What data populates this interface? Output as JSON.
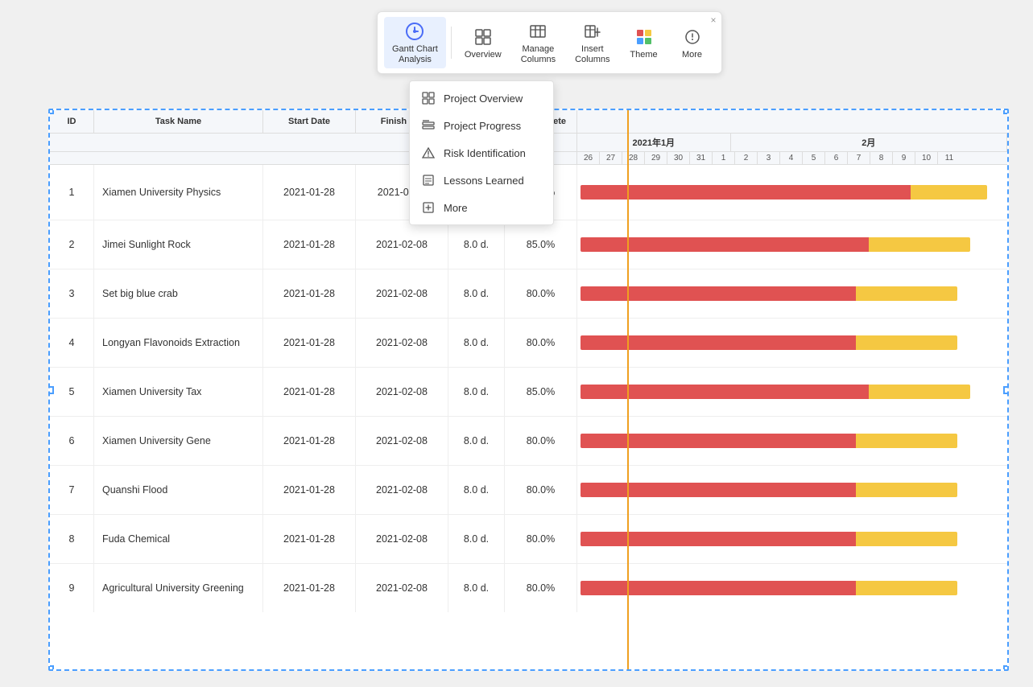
{
  "toolbar": {
    "close_label": "×",
    "items": [
      {
        "id": "gantt-chart-analysis",
        "label": "Gantt Chart\nAnalysis",
        "icon": "gantt-icon",
        "active": true
      },
      {
        "id": "overview",
        "label": "Overview",
        "icon": "overview-icon"
      },
      {
        "id": "manage-columns",
        "label": "Manage\nColumns",
        "icon": "manage-columns-icon"
      },
      {
        "id": "insert-columns",
        "label": "Insert\nColumns",
        "icon": "insert-columns-icon"
      },
      {
        "id": "theme",
        "label": "Theme",
        "icon": "theme-icon"
      },
      {
        "id": "more",
        "label": "More",
        "icon": "more-icon"
      }
    ]
  },
  "dropdown": {
    "items": [
      {
        "id": "project-overview",
        "label": "Project Overview",
        "icon": "grid-icon"
      },
      {
        "id": "project-progress",
        "label": "Project Progress",
        "icon": "progress-icon"
      },
      {
        "id": "risk-identification",
        "label": "Risk Identification",
        "icon": "risk-icon"
      },
      {
        "id": "lessons-learned",
        "label": "Lessons Learned",
        "icon": "lessons-icon"
      },
      {
        "id": "more",
        "label": "More",
        "icon": "more-plus-icon"
      }
    ]
  },
  "table": {
    "headers": [
      {
        "id": "col-id",
        "label": "ID"
      },
      {
        "id": "col-task",
        "label": "Task Name"
      },
      {
        "id": "col-start",
        "label": "Start Date"
      },
      {
        "id": "col-finish",
        "label": "Finish D..."
      },
      {
        "id": "col-duration",
        "label": ""
      },
      {
        "id": "col-complete",
        "label": "% Complete"
      }
    ],
    "months": [
      {
        "label": "2021年1月",
        "cols": 7
      },
      {
        "label": "2月",
        "cols": 11
      }
    ],
    "days": [
      26,
      27,
      28,
      29,
      30,
      31,
      1,
      2,
      3,
      4,
      5,
      6,
      7,
      8,
      9,
      10,
      11
    ],
    "rows": [
      {
        "id": 1,
        "task": "Xiamen University Physics",
        "start": "2021-01-28",
        "finish": "2021-02-...",
        "duration": "",
        "complete": "95.0%",
        "bar_done": 78,
        "bar_remaining": 18
      },
      {
        "id": 2,
        "task": "Jimei Sunlight Rock",
        "start": "2021-01-28",
        "finish": "2021-02-08",
        "duration": "8.0 d.",
        "complete": "85.0%",
        "bar_done": 68,
        "bar_remaining": 24
      },
      {
        "id": 3,
        "task": "Set big blue crab",
        "start": "2021-01-28",
        "finish": "2021-02-08",
        "duration": "8.0 d.",
        "complete": "80.0%",
        "bar_done": 65,
        "bar_remaining": 24
      },
      {
        "id": 4,
        "task": "Longyan Flavonoids Extraction",
        "start": "2021-01-28",
        "finish": "2021-02-08",
        "duration": "8.0 d.",
        "complete": "80.0%",
        "bar_done": 65,
        "bar_remaining": 24
      },
      {
        "id": 5,
        "task": "Xiamen University Tax",
        "start": "2021-01-28",
        "finish": "2021-02-08",
        "duration": "8.0 d.",
        "complete": "85.0%",
        "bar_done": 68,
        "bar_remaining": 24
      },
      {
        "id": 6,
        "task": "Xiamen University Gene",
        "start": "2021-01-28",
        "finish": "2021-02-08",
        "duration": "8.0 d.",
        "complete": "80.0%",
        "bar_done": 65,
        "bar_remaining": 24
      },
      {
        "id": 7,
        "task": "Quanshi Flood",
        "start": "2021-01-28",
        "finish": "2021-02-08",
        "duration": "8.0 d.",
        "complete": "80.0%",
        "bar_done": 65,
        "bar_remaining": 24
      },
      {
        "id": 8,
        "task": "Fuda Chemical",
        "start": "2021-01-28",
        "finish": "2021-02-08",
        "duration": "8.0 d.",
        "complete": "80.0%",
        "bar_done": 65,
        "bar_remaining": 24
      },
      {
        "id": 9,
        "task": "Agricultural University Greening",
        "start": "2021-01-28",
        "finish": "2021-02-08",
        "duration": "8.0 d.",
        "complete": "80.0%",
        "bar_done": 65,
        "bar_remaining": 24
      }
    ]
  },
  "colors": {
    "accent_blue": "#4a9eff",
    "bar_done": "#e05252",
    "bar_remaining": "#f5c842",
    "header_bg": "#f5f7fa",
    "separator": "#f0a020"
  }
}
